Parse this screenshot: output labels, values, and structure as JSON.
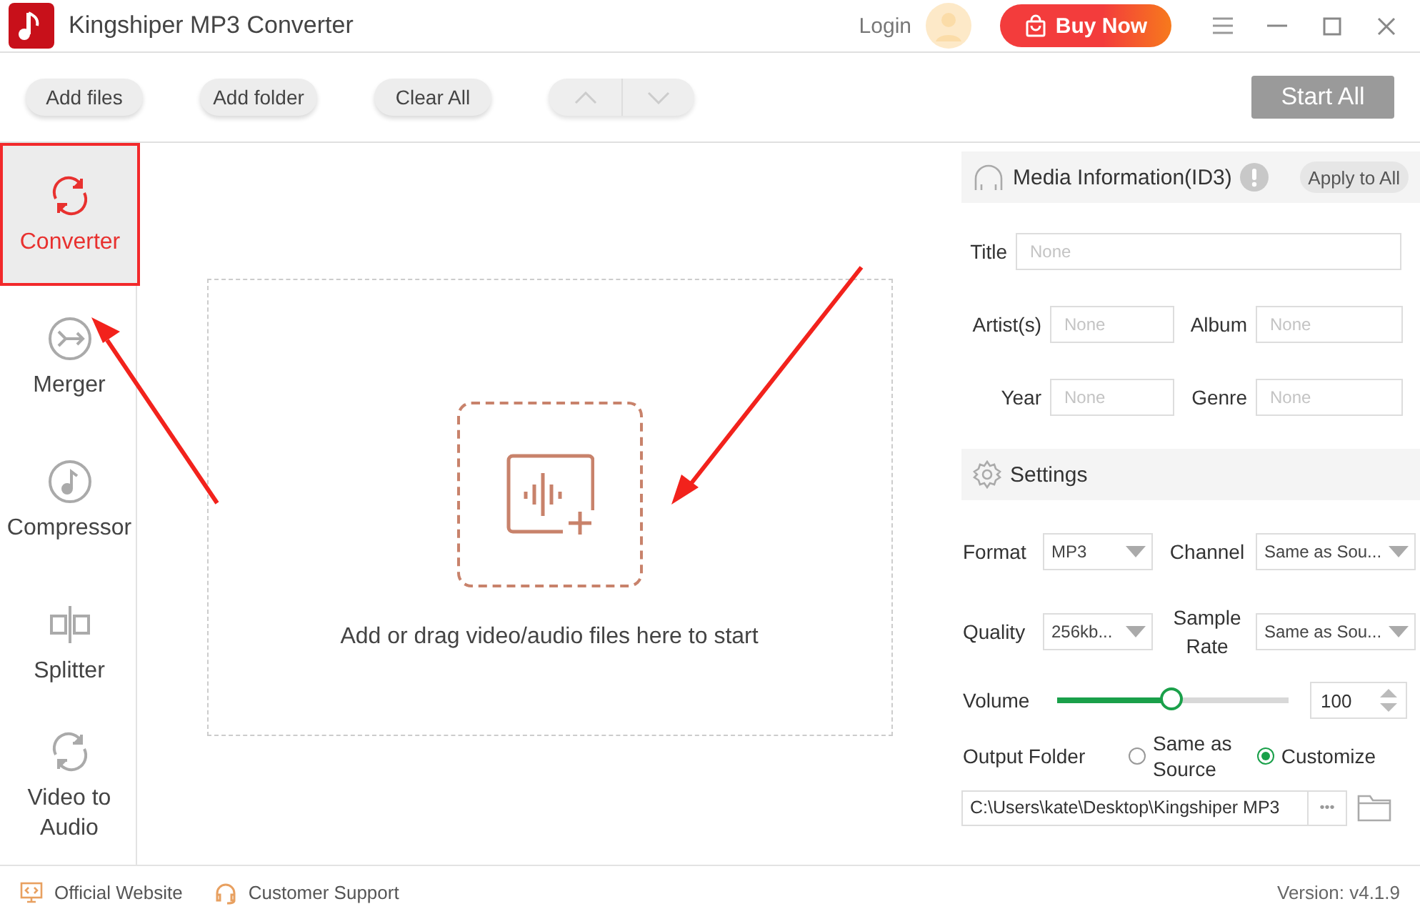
{
  "window": {
    "title": "Kingshiper MP3 Converter",
    "login": "Login",
    "buy": "Buy Now"
  },
  "toolbar": {
    "buttons": [
      "Add files",
      "Add folder",
      "Clear All"
    ],
    "start": "Start All"
  },
  "sidebar": {
    "items": [
      {
        "kind": "converter",
        "label": "Converter",
        "selected": true
      },
      {
        "kind": "merger",
        "label": "Merger",
        "selected": false
      },
      {
        "kind": "compressor",
        "label": "Compressor",
        "selected": false
      },
      {
        "kind": "splitter",
        "label": "Splitter",
        "selected": false
      },
      {
        "kind": "video",
        "label": "Video to Audio",
        "selected": false
      }
    ]
  },
  "dropzone": {
    "hint": "Add or drag video/audio files here to start"
  },
  "media_info": {
    "title": "Media Information(ID3)",
    "apply": "Apply to All",
    "title_field": {
      "label": "Title",
      "placeholder": "None"
    },
    "pairs": [
      [
        {
          "label": "Artist(s)",
          "placeholder": "None"
        },
        {
          "label": "Album",
          "placeholder": "None"
        }
      ],
      [
        {
          "label": "Year",
          "placeholder": "None"
        },
        {
          "label": "Genre",
          "placeholder": "None"
        }
      ]
    ]
  },
  "settings": {
    "title": "Settings",
    "rows": [
      [
        {
          "label": "Format",
          "value": "MP3"
        },
        {
          "label": "Channel",
          "value": "Same as Sou..."
        }
      ],
      [
        {
          "label": "Quality",
          "value": "256kb..."
        },
        {
          "label": "Sample Rate",
          "value": "Same as Sou..."
        }
      ]
    ],
    "volume": {
      "label": "Volume",
      "level": 0.49,
      "value": "100"
    },
    "output": {
      "label": "Output Folder",
      "options": [
        {
          "label": "Same as Source",
          "selected": false
        },
        {
          "label": "Customize",
          "selected": true
        }
      ],
      "path": "C:\\Users\\kate\\Desktop\\Kingshiper MP3",
      "more": "•••"
    }
  },
  "footer": {
    "links": [
      "Official Website",
      "Customer Support"
    ],
    "version": "Version: v4.1.9"
  }
}
